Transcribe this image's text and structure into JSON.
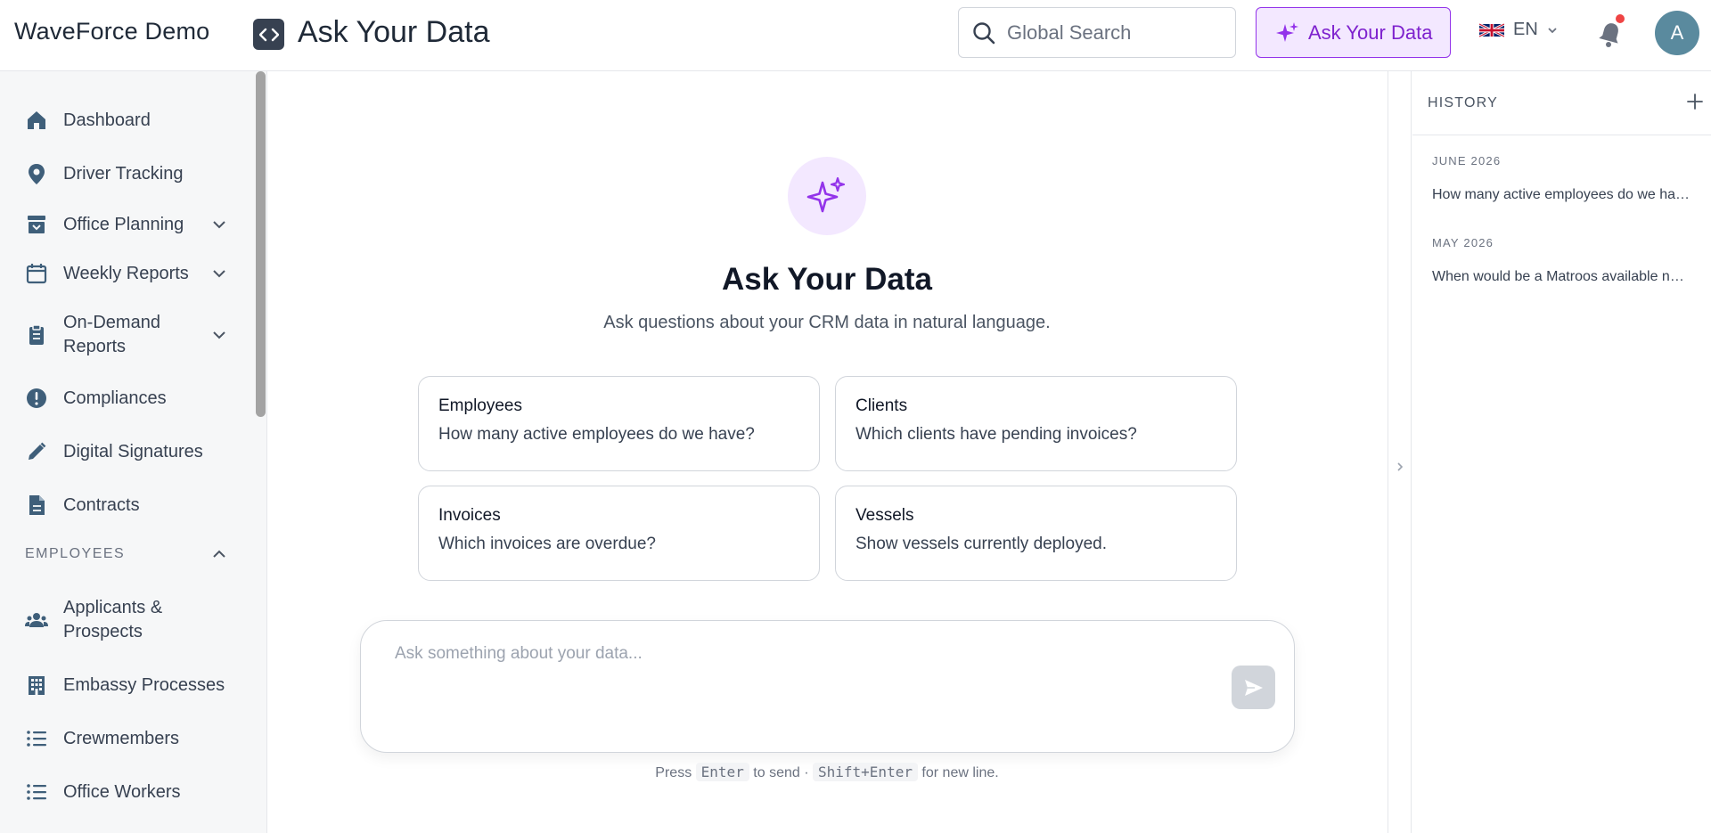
{
  "header": {
    "brand": "WaveForce Demo",
    "page_title": "Ask Your Data",
    "search_placeholder": "Global Search",
    "ask_button_label": "Ask Your Data",
    "language": "EN",
    "avatar_initial": "A"
  },
  "sidebar": {
    "items": [
      {
        "label": "Dashboard"
      },
      {
        "label": "Driver Tracking"
      },
      {
        "label": "Office Planning"
      },
      {
        "label": "Weekly Reports"
      },
      {
        "label": "On-Demand Reports"
      },
      {
        "label": "Compliances"
      },
      {
        "label": "Digital Signatures"
      },
      {
        "label": "Contracts"
      }
    ],
    "section_employees": "EMPLOYEES",
    "employee_items": [
      {
        "label": "Applicants & Prospects"
      },
      {
        "label": "Embassy Processes"
      },
      {
        "label": "Crewmembers"
      },
      {
        "label": "Office Workers"
      }
    ]
  },
  "main": {
    "title": "Ask Your Data",
    "subtitle": "Ask questions about your CRM data in natural language.",
    "suggestions": [
      {
        "title": "Employees",
        "question": "How many active employees do we have?"
      },
      {
        "title": "Clients",
        "question": "Which clients have pending invoices?"
      },
      {
        "title": "Invoices",
        "question": "Which invoices are overdue?"
      },
      {
        "title": "Vessels",
        "question": "Show vessels currently deployed."
      }
    ],
    "composer_placeholder": "Ask something about your data...",
    "hint": {
      "press": "Press",
      "enter_key": "Enter",
      "to_send": "to send ·",
      "shift_enter_key": "Shift+Enter",
      "new_line": "for new line."
    }
  },
  "history": {
    "title": "HISTORY",
    "groups": [
      {
        "month": "JUNE 2026",
        "items": [
          "How many active employees do we have?"
        ]
      },
      {
        "month": "MAY 2026",
        "items": [
          "When would be a Matroos available next week?"
        ]
      }
    ]
  },
  "colors": {
    "accent_purple": "#9333ea",
    "accent_purple_bg": "#f3e8ff",
    "nav_icon": "#3f5f7a",
    "notification_dot": "#ef4444",
    "avatar_bg": "#5a8a9e"
  },
  "icons": {
    "brand_toggle": "code-brackets-icon",
    "search": "search-icon",
    "ask": "sparkles-icon",
    "flag": "uk-flag-icon",
    "notifications": "bell-icon",
    "send": "send-icon",
    "history_add": "plus-icon",
    "collapse": "chevron-right-icon"
  }
}
